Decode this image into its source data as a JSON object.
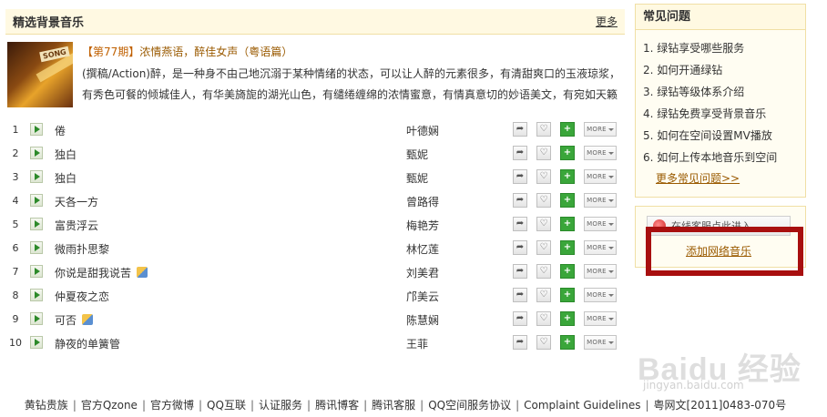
{
  "main": {
    "title": "精选背景音乐",
    "more_label": "更多",
    "feature": {
      "issue": "【第77期】",
      "subtitle": "浓情燕语，醉佳女声（粤语篇）",
      "cover_tag": "SONG",
      "description": "(撰稿/Action)醉，是一种身不由己地沉溺于某种情绪的状态，可以让人醉的元素很多，有清甜爽口的玉液琼浆，有秀色可餐的倾城佳人，有华美旖旎的湖光山色，有缱绻缠绵的浓情蜜意，有情真意切的妙语美文，有宛如天籁"
    },
    "songs": [
      {
        "num": "1",
        "title": "倦",
        "artist": "叶德娴",
        "hq": false
      },
      {
        "num": "2",
        "title": "独白",
        "artist": "甄妮",
        "hq": false
      },
      {
        "num": "3",
        "title": "独白",
        "artist": "甄妮",
        "hq": false
      },
      {
        "num": "4",
        "title": "天各一方",
        "artist": "曾路得",
        "hq": false
      },
      {
        "num": "5",
        "title": "富贵浮云",
        "artist": "梅艳芳",
        "hq": false
      },
      {
        "num": "6",
        "title": "微雨扑思黎",
        "artist": "林忆莲",
        "hq": false
      },
      {
        "num": "7",
        "title": "你说是甜我说苦",
        "artist": "刘美君",
        "hq": true
      },
      {
        "num": "8",
        "title": "仲夏夜之恋",
        "artist": "邝美云",
        "hq": false
      },
      {
        "num": "9",
        "title": "可否",
        "artist": "陈慧娴",
        "hq": true
      },
      {
        "num": "10",
        "title": "静夜的单簧管",
        "artist": "王菲",
        "hq": false
      }
    ],
    "more_button_label": "MORE"
  },
  "faq": {
    "title": "常见问题",
    "items": [
      "1. 绿钻享受哪些服务",
      "2. 如何开通绿钻",
      "3. 绿钻等级体系介绍",
      "4. 绿钻免费享受背景音乐",
      "5. 如何在空间设置MV播放",
      "6. 如何上传本地音乐到空间"
    ],
    "more_label": "更多常见问题>>"
  },
  "service": {
    "button_label": "在线客服点此进入",
    "add_link": "添加网络音乐"
  },
  "watermark": {
    "brand": "Baidu 经验",
    "url": "jingyan.baidu.com"
  },
  "footer": {
    "links": [
      "黄钻贵族",
      "官方Qzone",
      "官方微博",
      "QQ互联",
      "认证服务",
      "腾讯博客",
      "腾讯客服",
      "QQ空间服务协议",
      "Complaint Guidelines",
      "粤网文[2011]0483-070号"
    ]
  },
  "colors": {
    "header_bg": "#fff9e2",
    "border": "#f0dfa5",
    "link_brown": "#9a5a00",
    "highlight_red": "#a80f0f",
    "add_green": "#3aa63a"
  }
}
